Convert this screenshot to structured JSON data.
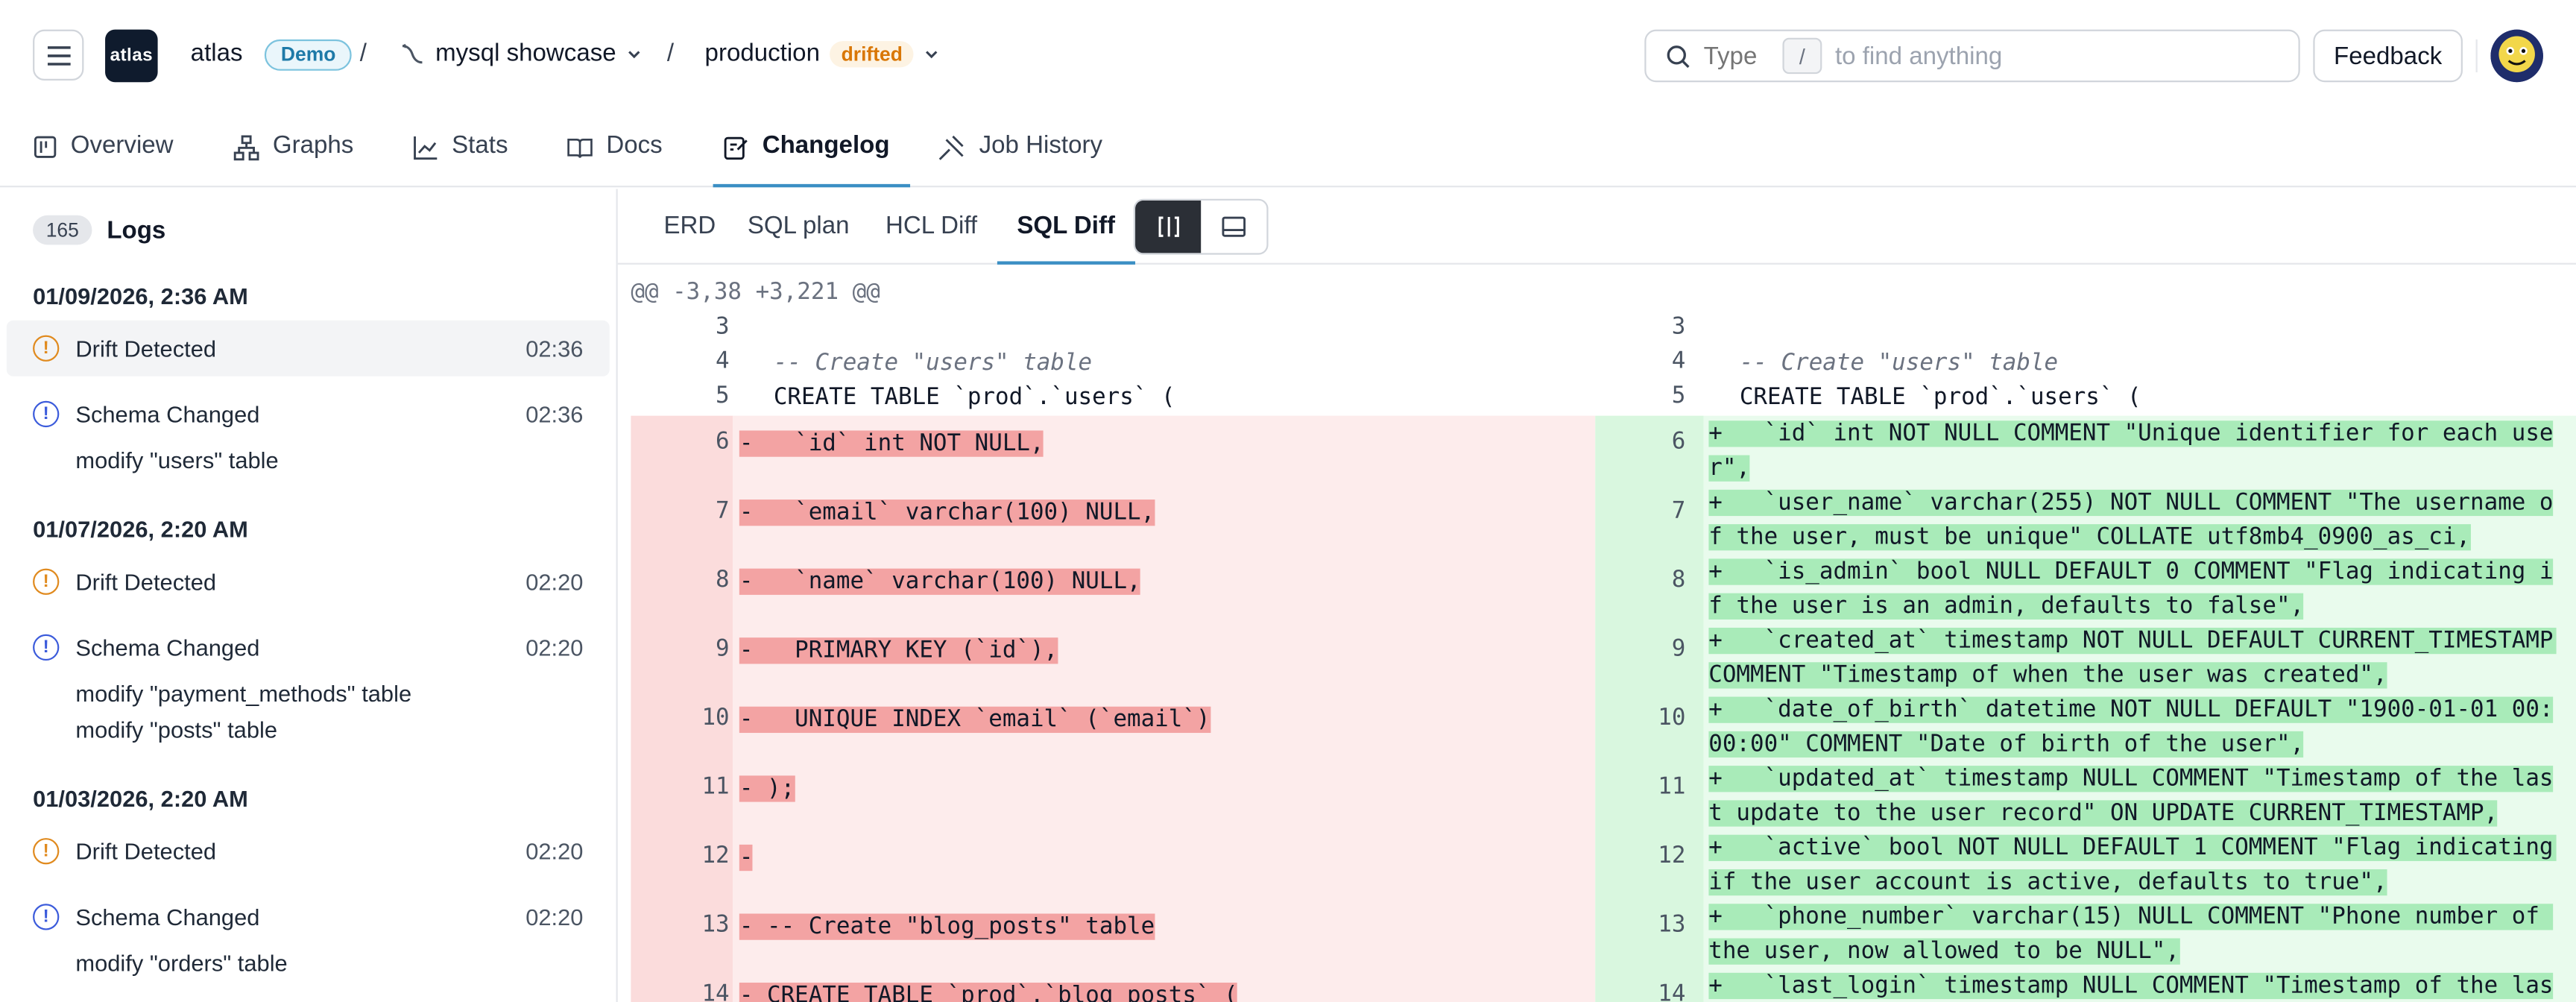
{
  "header": {
    "app_name": "atlas",
    "logo_text": "atlas",
    "badge": "Demo",
    "separator": "/",
    "project": "mysql showcase",
    "environment": "production",
    "env_status": "drifted",
    "search_placeholder": "Type",
    "search_key": "/",
    "search_hint": "to find anything",
    "feedback": "Feedback"
  },
  "tabs": [
    {
      "label": "Overview",
      "icon": "overview-icon"
    },
    {
      "label": "Graphs",
      "icon": "graph-icon"
    },
    {
      "label": "Stats",
      "icon": "stats-icon"
    },
    {
      "label": "Docs",
      "icon": "docs-icon"
    },
    {
      "label": "Changelog",
      "icon": "changelog-icon",
      "active": true
    },
    {
      "label": "Job History",
      "icon": "job-history-icon"
    }
  ],
  "sidebar": {
    "count": "165",
    "title": "Logs",
    "groups": [
      {
        "date": "01/09/2026, 2:36 AM",
        "items": [
          {
            "type": "Drift Detected",
            "time": "02:36",
            "selected": true,
            "details": []
          },
          {
            "type": "Schema Changed",
            "time": "02:36",
            "details": [
              "modify \"users\" table"
            ]
          }
        ]
      },
      {
        "date": "01/07/2026, 2:20 AM",
        "items": [
          {
            "type": "Drift Detected",
            "time": "02:20",
            "details": []
          },
          {
            "type": "Schema Changed",
            "time": "02:20",
            "details": [
              "modify \"payment_methods\" table",
              "modify \"posts\" table"
            ]
          }
        ]
      },
      {
        "date": "01/03/2026, 2:20 AM",
        "items": [
          {
            "type": "Drift Detected",
            "time": "02:20",
            "details": []
          },
          {
            "type": "Schema Changed",
            "time": "02:20",
            "details": [
              "modify \"orders\" table"
            ]
          }
        ]
      }
    ]
  },
  "subtabs": [
    "ERD",
    "SQL plan",
    "HCL Diff",
    "SQL Diff"
  ],
  "active_subtab": "SQL Diff",
  "diff": {
    "hunk": "@@ -3,38 +3,221 @@",
    "left_lines": [
      {
        "n": "3",
        "text": ""
      },
      {
        "n": "4",
        "text": "  -- Create \"users\" table"
      },
      {
        "n": "5",
        "text": "  CREATE TABLE `prod`.`users` ("
      },
      {
        "n": "6",
        "text": "-   `id` int NOT NULL,"
      },
      {
        "n": "7",
        "text": "-   `email` varchar(100) NULL,"
      },
      {
        "n": "8",
        "text": "-   `name` varchar(100) NULL,"
      },
      {
        "n": "9",
        "text": "-   PRIMARY KEY (`id`),"
      },
      {
        "n": "10",
        "text": "-   UNIQUE INDEX `email` (`email`)"
      },
      {
        "n": "11",
        "text": "- );"
      },
      {
        "n": "12",
        "text": "-"
      },
      {
        "n": "13",
        "text": "- -- Create \"blog_posts\" table"
      },
      {
        "n": "14",
        "text": "- CREATE TABLE `prod`.`blog_posts` ("
      }
    ],
    "right_lines": [
      {
        "n": "3",
        "text": ""
      },
      {
        "n": "4",
        "text": "  -- Create \"users\" table"
      },
      {
        "n": "5",
        "text": "  CREATE TABLE `prod`.`users` ("
      },
      {
        "n": "6",
        "text": "+   `id` int NOT NULL COMMENT \"Unique identifier for each user\","
      },
      {
        "n": "7",
        "text": "+   `user_name` varchar(255) NOT NULL COMMENT \"The username of the user, must be unique\" COLLATE utf8mb4_0900_as_ci,"
      },
      {
        "n": "8",
        "text": "+   `is_admin` bool NULL DEFAULT 0 COMMENT \"Flag indicating if the user is an admin, defaults to false\","
      },
      {
        "n": "9",
        "text": "+   `created_at` timestamp NOT NULL DEFAULT CURRENT_TIMESTAMP COMMENT \"Timestamp of when the user was created\","
      },
      {
        "n": "10",
        "text": "+   `date_of_birth` datetime NOT NULL DEFAULT \"1900-01-01 00:00:00\" COMMENT \"Date of birth of the user\","
      },
      {
        "n": "11",
        "text": "+   `updated_at` timestamp NULL COMMENT \"Timestamp of the last update to the user record\" ON UPDATE CURRENT_TIMESTAMP,"
      },
      {
        "n": "12",
        "text": "+   `active` bool NOT NULL DEFAULT 1 COMMENT \"Flag indicating if the user account is active, defaults to true\","
      },
      {
        "n": "13",
        "text": "+   `phone_number` varchar(15) NULL COMMENT \"Phone number of the user, now allowed to be NULL\","
      },
      {
        "n": "14",
        "text": "+   `last_login` timestamp NULL COMMENT \"Timestamp of the las"
      }
    ]
  },
  "colors": {
    "accent": "#3b8fc4",
    "drift": "#e08a1e",
    "change": "#3b5bdb",
    "del_bg": "#fdecec",
    "add_bg": "#e9fbed"
  }
}
